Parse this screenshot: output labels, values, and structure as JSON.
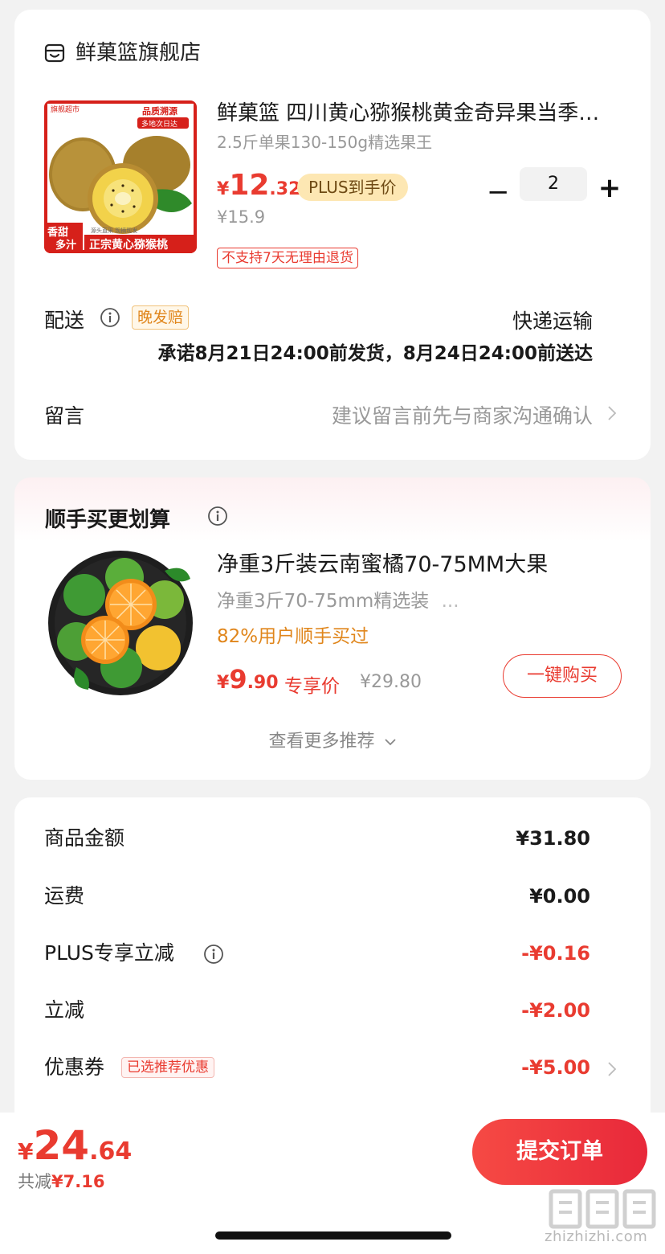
{
  "store": {
    "name": "鲜菓篮旗舰店",
    "product": {
      "title": "鲜菓篮 四川黄心猕猴桃黄金奇异果当季新鲜水果",
      "spec": "2.5斤单果130-150g精选果王",
      "price_currency": "¥",
      "price_int": "12",
      "price_dec": ".32",
      "plus_badge": "PLUS到手价",
      "orig_price": "¥15.9",
      "return_tag": "不支持7天无理由退货",
      "img_texts": {
        "brand": "旗舰超市",
        "quality": "品质溯源",
        "ship": "多地次日达",
        "tag1": "香甜",
        "tag2": "多汁",
        "banner": "正宗黄心猕猴桃",
        "small": "源头直采 现摘现发"
      },
      "quantity": "2",
      "minus_symbol": "−",
      "plus_symbol": "+"
    },
    "delivery": {
      "label": "配送",
      "late_tag": "晚发赔",
      "method": "快递运输",
      "promise": "承诺8月21日24:00前发货，8月24日24:00前送达"
    },
    "note": {
      "label": "留言",
      "placeholder": "建议留言前先与商家沟通确认"
    }
  },
  "recommend": {
    "title": "顺手买更划算",
    "item": {
      "name": "净重3斤装云南蜜橘70-75MM大果",
      "spec": "净重3斤70-75mm精选装",
      "spec_more": "...",
      "bought": "82%用户顺手买过",
      "price_currency": "¥",
      "price_int": "9",
      "price_dec": ".90",
      "exclusive": "专享价",
      "orig_price": "¥29.80",
      "buy_button": "一键购买"
    },
    "more": "查看更多推荐"
  },
  "summary": {
    "rows": [
      {
        "label": "商品金额",
        "value": "¥31.80"
      },
      {
        "label": "运费",
        "value": "¥0.00"
      },
      {
        "label": "PLUS专享立减",
        "value": "-¥0.16"
      },
      {
        "label": "立减",
        "value": "-¥2.00"
      },
      {
        "label": "优惠券",
        "value": "-¥5.00",
        "tag": "已选推荐优惠"
      }
    ]
  },
  "bottom": {
    "total_currency": "¥",
    "total_int": "24",
    "total_dec": ".64",
    "saved_label": "共减",
    "saved_amount": "¥7.16",
    "submit": "提交订单",
    "watermark": "zhizhizhi.com"
  },
  "colors": {
    "accent_red": "#e93b30",
    "plus_gold": "#fde7b3",
    "orange_text": "#e0861c"
  }
}
